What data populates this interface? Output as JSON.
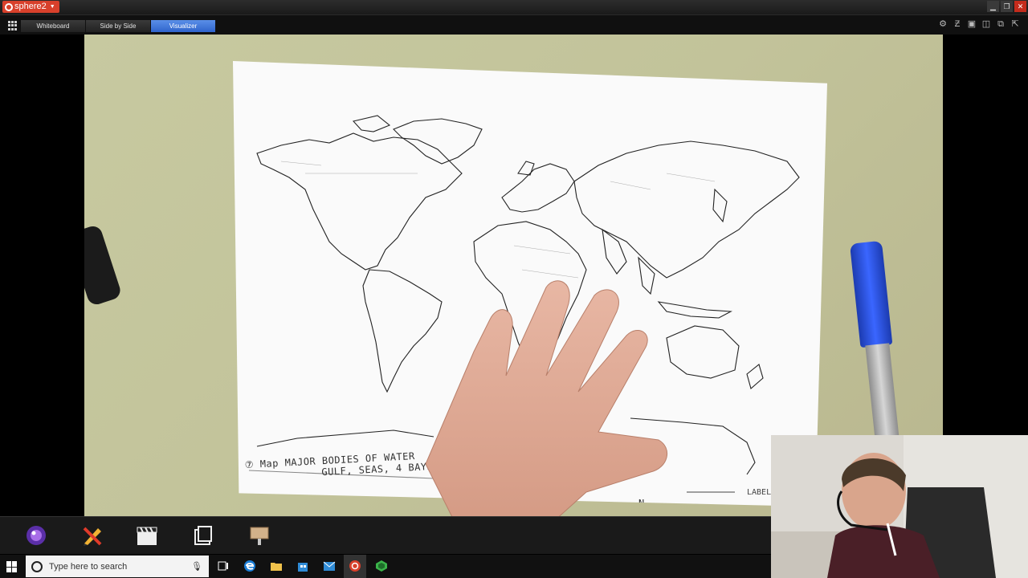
{
  "app": {
    "name": "sphere2",
    "brand_color": "#d8402b"
  },
  "window_controls": [
    {
      "name": "minimize",
      "glyph": "▁"
    },
    {
      "name": "maximize",
      "glyph": "❐"
    },
    {
      "name": "close",
      "glyph": "✕"
    }
  ],
  "tabs": [
    {
      "label": "Whiteboard",
      "active": false
    },
    {
      "label": "Side by Side",
      "active": false
    },
    {
      "label": "Visualizer",
      "active": true
    }
  ],
  "toolbar_icons": [
    "camera-settings-icon",
    "freeze-icon",
    "layout-icon",
    "split-icon",
    "snapshot-icon",
    "popout-icon"
  ],
  "document": {
    "handwriting_line1": "⑦   Map  MAJOR BODIES OF WATER",
    "handwriting_line2": "GULF, SEAS, 4 BAYS",
    "handwriting_n": "N",
    "handwriting_label": "LABEL"
  },
  "bottom_tools": [
    "lens-icon",
    "annotate-pencil-icon",
    "clapper-icon",
    "gallery-icon",
    "presentation-icon"
  ],
  "taskbar": {
    "search_placeholder": "Type here to search",
    "apps": [
      "task-view-icon",
      "edge-icon",
      "file-explorer-icon",
      "store-icon",
      "mail-icon",
      "sphere2-icon",
      "app-green-icon"
    ]
  }
}
